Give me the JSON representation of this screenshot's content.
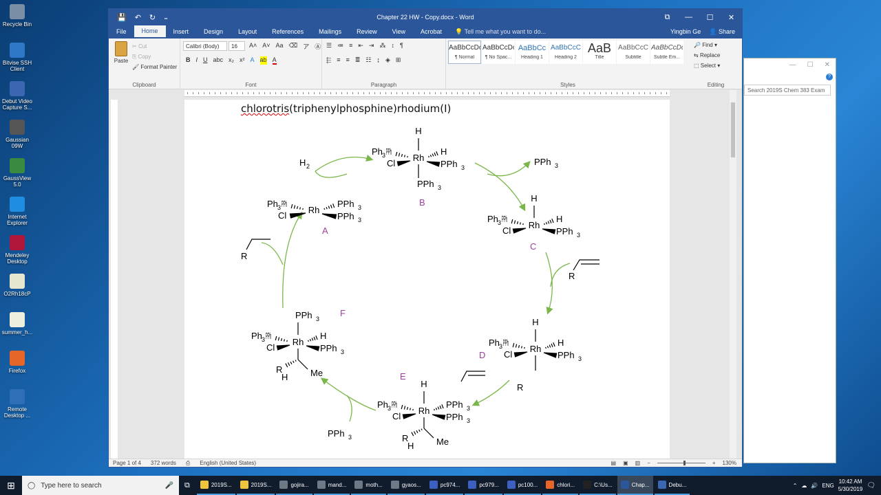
{
  "desktop": {
    "icons": [
      {
        "label": "Recycle Bin",
        "color": "#7a8fa5"
      },
      {
        "label": "Bitvise SSH Client",
        "color": "#2e78c7"
      },
      {
        "label": "Debut Video Capture S...",
        "color": "#3b66b2"
      },
      {
        "label": "Gaussian 09W",
        "color": "#555555"
      },
      {
        "label": "GaussView 5.0",
        "color": "#3a8a40"
      },
      {
        "label": "Internet Explorer",
        "color": "#1f8de0"
      },
      {
        "label": "Mendeley Desktop",
        "color": "#b0173a"
      },
      {
        "label": "O2Rh18cP",
        "color": "#e7e7d0"
      },
      {
        "label": "summer_h...",
        "color": "#efefe0"
      },
      {
        "label": "Firefox",
        "color": "#e6662a"
      },
      {
        "label": "Remote Desktop ...",
        "color": "#2e6fb8"
      }
    ]
  },
  "background_window": {
    "search_placeholder": "Search 2019S Chem 383 Exam",
    "min": "—",
    "max": "☐",
    "close": "✕",
    "help": "?"
  },
  "word": {
    "title": "Chapter 22 HW - Copy.docx - Word",
    "qat": {
      "save": "💾",
      "undo": "↶",
      "redo": "↻",
      "more": "₌"
    },
    "window_controls": {
      "ribbon_opts": "⧉",
      "min": "—",
      "max": "☐",
      "close": "✕"
    },
    "tabs": [
      "File",
      "Home",
      "Insert",
      "Design",
      "Layout",
      "References",
      "Mailings",
      "Review",
      "View",
      "Acrobat"
    ],
    "tell_me": "Tell me what you want to do...",
    "user": "Yingbin Ge",
    "share": "Share",
    "ribbon": {
      "paste": "Paste",
      "cut": "Cut",
      "copy": "Copy",
      "format_painter": "Format Painter",
      "clipboard_label": "Clipboard",
      "font_name": "Calibri (Body)",
      "font_size": "16",
      "font_label": "Font",
      "paragraph_label": "Paragraph",
      "styles": [
        {
          "preview": "AaBbCcDc",
          "name": "¶ Normal"
        },
        {
          "preview": "AaBbCcDc",
          "name": "¶ No Spac..."
        },
        {
          "preview": "AaBbCc",
          "name": "Heading 1"
        },
        {
          "preview": "AaBbCcC",
          "name": "Heading 2"
        },
        {
          "preview": "AaB",
          "name": "Title"
        },
        {
          "preview": "AaBbCcC",
          "name": "Subtitle"
        },
        {
          "preview": "AaBbCcDc",
          "name": "Subtle Em..."
        }
      ],
      "styles_label": "Styles",
      "find": "Find",
      "replace": "Replace",
      "select": "Select",
      "editing_label": "Editing"
    },
    "document": {
      "heading_pre": "chlorotris",
      "heading_post": "(triphenylphosphine)rhodium(I)",
      "green": "#7ab648",
      "purple": "#9c3f9c",
      "complex_labels": [
        "A",
        "B",
        "C",
        "D",
        "E",
        "F"
      ],
      "atoms": {
        "Rh": "Rh",
        "H": "H",
        "Cl": "Cl",
        "R": "R",
        "Me": "Me",
        "Ph3P": "Ph",
        "PPh3": "PPh",
        "sub3": "3",
        "H2": "H",
        "sub2": "2"
      }
    },
    "status": {
      "page": "Page 1 of 4",
      "words": "372 words",
      "language": "English (United States)",
      "zoom": "130%"
    }
  },
  "taskbar": {
    "search_placeholder": "Type here to search",
    "apps": [
      {
        "label": "2019S...",
        "color": "#f0c43c"
      },
      {
        "label": "2019S...",
        "color": "#f0c43c"
      },
      {
        "label": "gojira...",
        "color": "#6d7a86"
      },
      {
        "label": "mand...",
        "color": "#6d7a86"
      },
      {
        "label": "moth...",
        "color": "#6d7a86"
      },
      {
        "label": "gyaos...",
        "color": "#6d7a86"
      },
      {
        "label": "pc974...",
        "color": "#3c5fc0"
      },
      {
        "label": "pc979...",
        "color": "#3c5fc0"
      },
      {
        "label": "pc100...",
        "color": "#3c5fc0"
      },
      {
        "label": "chlori...",
        "color": "#e6662a"
      },
      {
        "label": "C:\\Us...",
        "color": "#222222"
      },
      {
        "label": "Chap...",
        "color": "#2b579a"
      },
      {
        "label": "Debu...",
        "color": "#3b66b2"
      }
    ],
    "lang": "ENG",
    "time": "10:42 AM",
    "date": "5/30/2019"
  }
}
